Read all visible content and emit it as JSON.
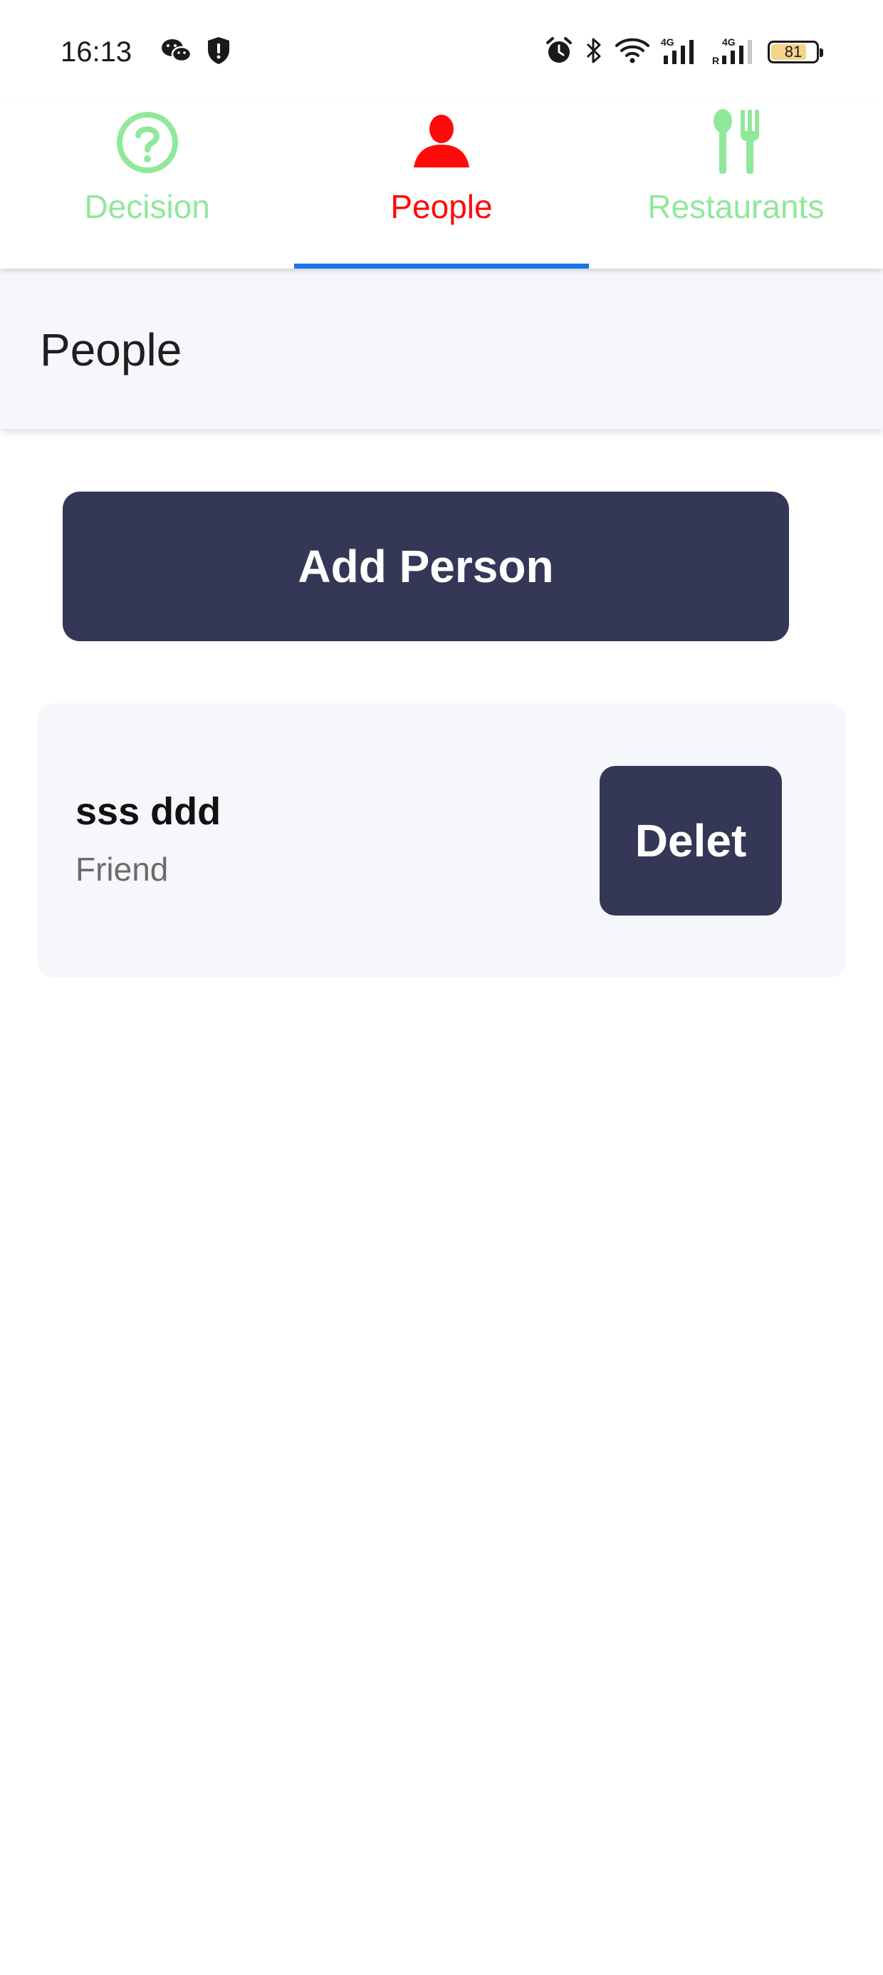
{
  "status_bar": {
    "time": "16:13",
    "battery_level": "81",
    "left_icons": [
      "wechat-icon",
      "shield-icon"
    ],
    "right_icons": [
      "alarm-icon",
      "bluetooth-icon",
      "wifi-icon",
      "signal-4g-icon",
      "signal-4g-roaming-icon",
      "battery-icon"
    ]
  },
  "tabs": [
    {
      "label": "Decision",
      "icon": "question-circle-icon",
      "color": "#90e89a",
      "active": false
    },
    {
      "label": "People",
      "icon": "person-icon",
      "color": "#ff0a0a",
      "active": true
    },
    {
      "label": "Restaurants",
      "icon": "fork-spoon-icon",
      "color": "#90e89a",
      "active": false
    }
  ],
  "tab_indicator_color": "#1a73e8",
  "header": {
    "title": "People"
  },
  "main": {
    "add_button_label": "Add Person",
    "people": [
      {
        "name": "sss ddd",
        "relation": "Friend",
        "delete_label": "Delet"
      }
    ]
  },
  "colors": {
    "button_bg": "#343756",
    "header_bg": "#f5f7fb",
    "card_bg": "#f5f7fb"
  }
}
